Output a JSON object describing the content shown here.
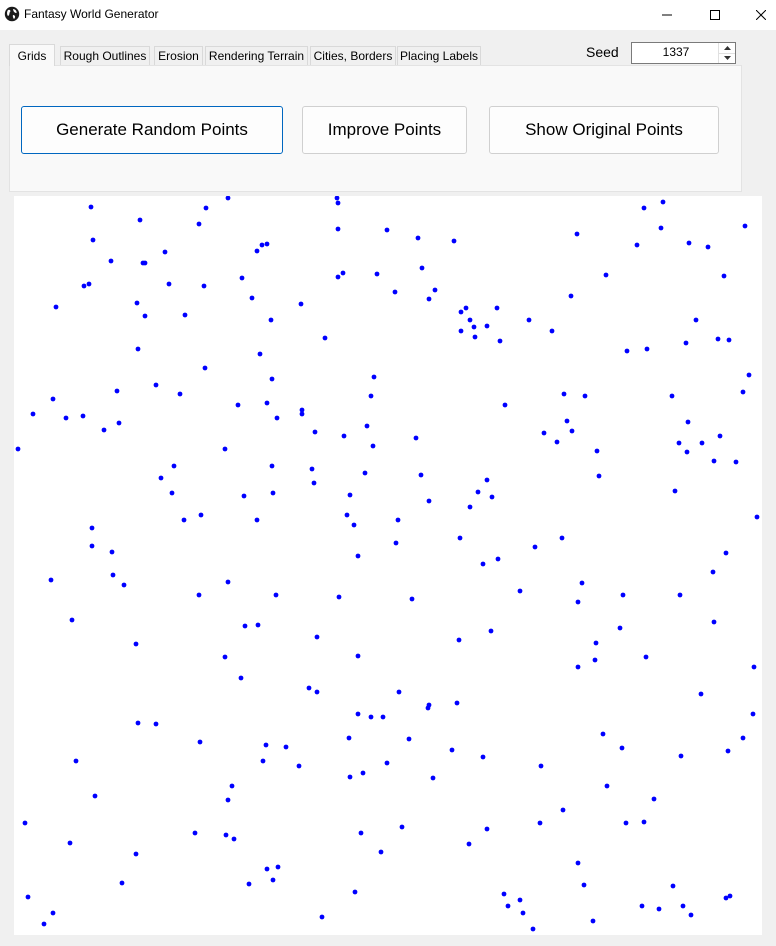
{
  "window": {
    "title": "Fantasy World Generator",
    "icon": "globe-icon"
  },
  "tabs": [
    {
      "label": "Grids",
      "active": true
    },
    {
      "label": "Rough Outlines",
      "active": false
    },
    {
      "label": "Erosion",
      "active": false
    },
    {
      "label": "Rendering Terrain",
      "active": false
    },
    {
      "label": "Cities, Borders",
      "active": false
    },
    {
      "label": "Placing Labels",
      "active": false
    }
  ],
  "seed": {
    "label": "Seed",
    "value": "1337"
  },
  "buttons": {
    "generate": "Generate Random Points",
    "improve": "Improve Points",
    "show_original": "Show Original Points"
  },
  "colors": {
    "point": "#0000ff",
    "focus_border": "#0067c0",
    "canvas_bg": "#ffffff"
  }
}
